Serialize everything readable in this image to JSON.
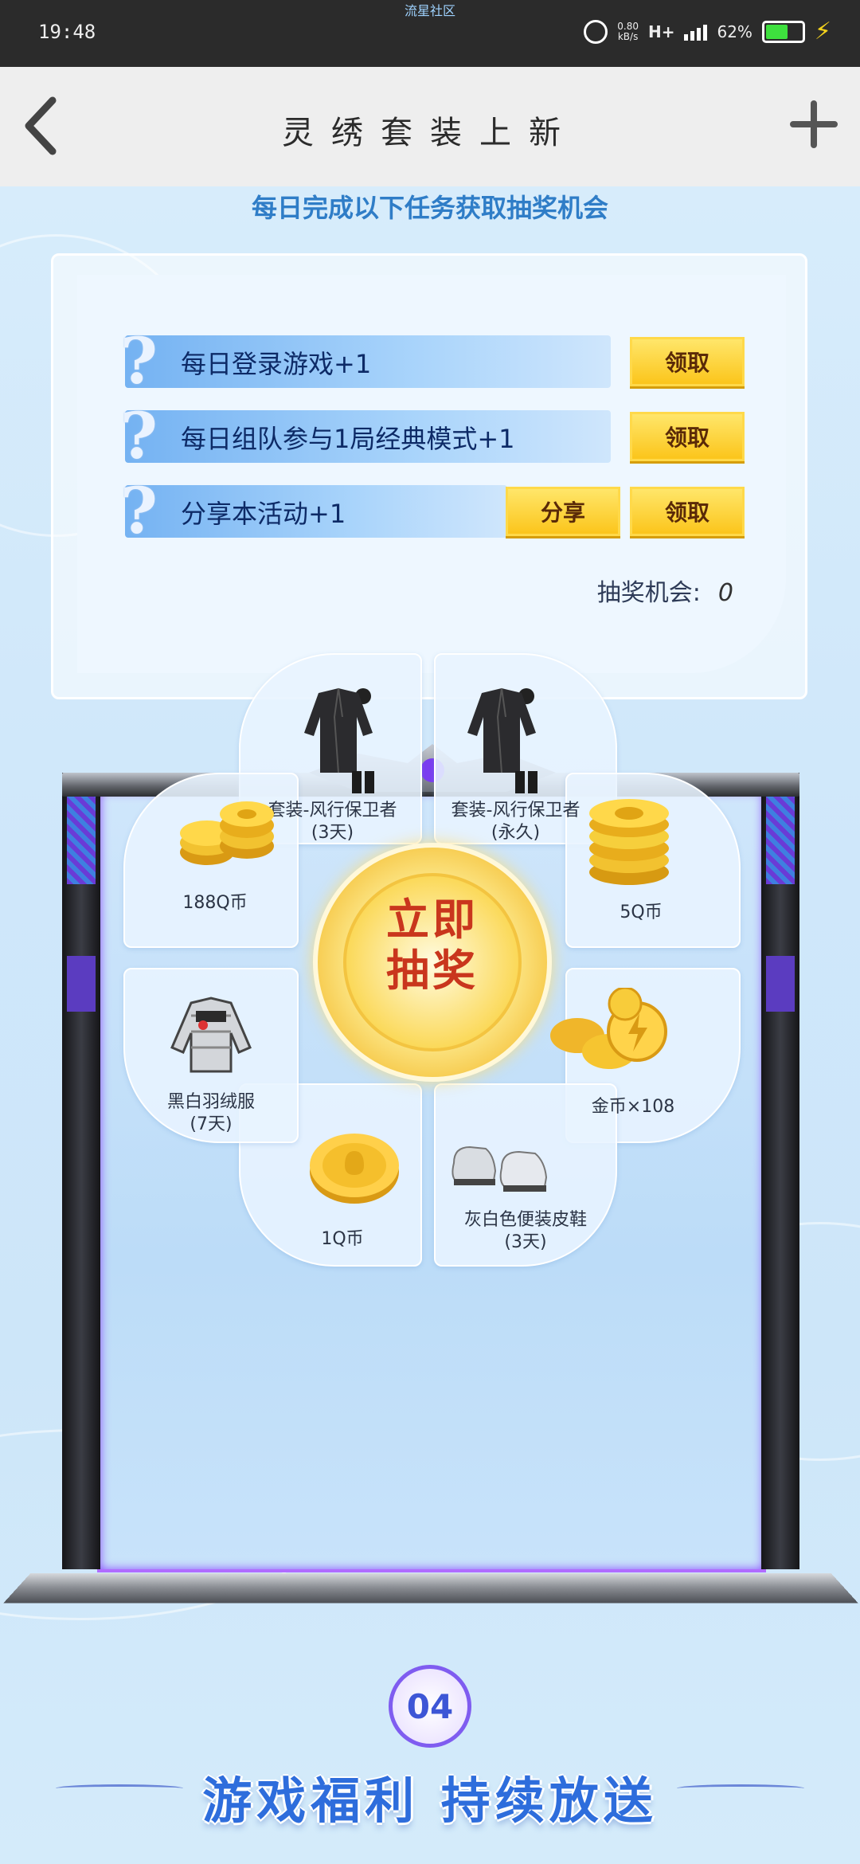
{
  "status_bar": {
    "time": "19:48",
    "carrier_text": "流星社区",
    "net_speed_value": "0.80",
    "net_speed_unit": "kB/s",
    "network_type": "H+",
    "battery_percent": "62%",
    "battery_level": 0.62
  },
  "nav": {
    "title": "灵绣套装上新",
    "back_icon": "chevron-left-icon",
    "add_icon": "plus-icon"
  },
  "tasks": {
    "subtitle": "每日完成以下任务获取抽奖机会",
    "items": [
      {
        "label": "每日登录游戏+1",
        "claim_label": "领取"
      },
      {
        "label": "每日组队参与1局经典模式+1",
        "claim_label": "领取"
      },
      {
        "label": "分享本活动+1",
        "share_label": "分享",
        "claim_label": "领取"
      }
    ],
    "chance_label": "抽奖机会:",
    "chance_value": "0"
  },
  "lottery": {
    "center_label_line1": "立即",
    "center_label_line2": "抽奖",
    "prizes": [
      {
        "name_line1": "套装-风行保卫者",
        "name_line2": "(3天)",
        "icon": "coat-icon"
      },
      {
        "name_line1": "套装-风行保卫者",
        "name_line2": "(永久)",
        "icon": "coat-icon"
      },
      {
        "name_line1": "5Q币",
        "name_line2": "",
        "icon": "coin-stack-icon"
      },
      {
        "name_line1": "金币×108",
        "name_line2": "",
        "icon": "gold-coins-icon"
      },
      {
        "name_line1": "灰白色便装皮鞋",
        "name_line2": "(3天)",
        "icon": "shoes-icon"
      },
      {
        "name_line1": "1Q币",
        "name_line2": "",
        "icon": "coin-icon"
      },
      {
        "name_line1": "黑白羽绒服",
        "name_line2": "(7天)",
        "icon": "jacket-icon"
      },
      {
        "name_line1": "188Q币",
        "name_line2": "",
        "icon": "coin-stack-icon"
      }
    ]
  },
  "section4": {
    "number": "04",
    "title": "游戏福利 持续放送"
  },
  "colors": {
    "accent_blue": "#2f7dc7",
    "button_yellow": "#fbc51b",
    "purple_frame": "#8a4bff",
    "draw_red": "#c9361d"
  }
}
